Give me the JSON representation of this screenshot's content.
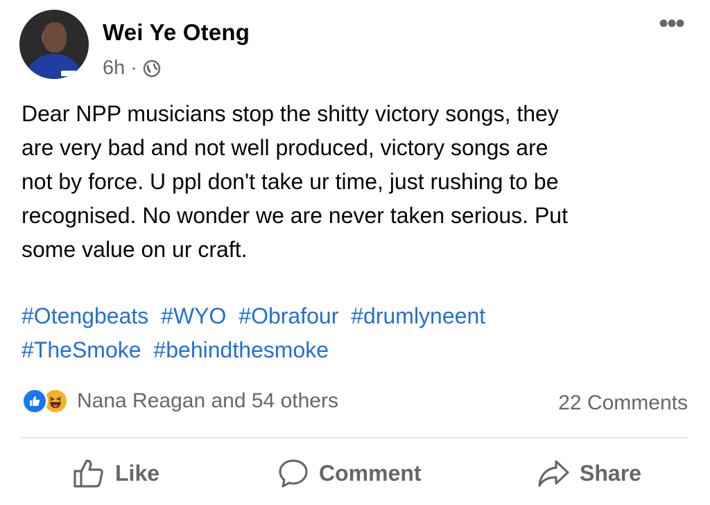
{
  "post": {
    "author": "Wei Ye Oteng",
    "time": "6h",
    "separator": "·",
    "privacy_icon": "globe-icon",
    "text": "Dear NPP musicians stop the shitty victory songs, they\nare very bad and not well produced,  victory songs are\nnot by force. U ppl don't take ur time, just rushing to be\nrecognised. No wonder we are never taken serious. Put\nsome value on ur craft.",
    "hashtags": [
      "#Otengbeats",
      "#WYO",
      "#Obrafour",
      "#drumlyneent",
      "#TheSmoke",
      "#behindthesmoke"
    ]
  },
  "reactions": {
    "icons": [
      "like-reaction-icon",
      "haha-reaction-icon"
    ],
    "summary": "Nana Reagan and 54 others",
    "comments": "22 Comments"
  },
  "actions": {
    "like": "Like",
    "comment": "Comment",
    "share": "Share"
  },
  "colors": {
    "hashtag": "#216fdb",
    "secondary_text": "#65676b",
    "like_blue": "#1877f2",
    "haha_yellow": "#f7b125"
  }
}
